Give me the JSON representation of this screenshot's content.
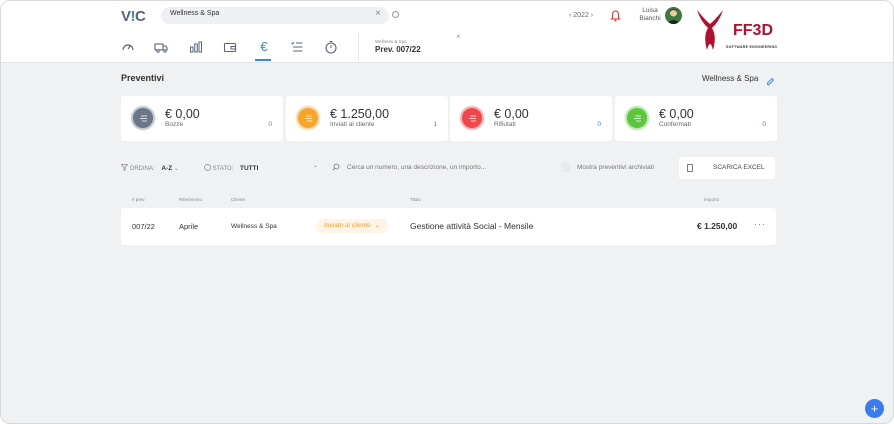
{
  "header": {
    "logo_text": "V",
    "logo_bang": "!",
    "logo_end": "C",
    "search_value": "Wellness & Spa",
    "search_clear": "×",
    "year": "‹ 2022 ›",
    "user_first": "Luisa",
    "user_last": "Bianchi",
    "brand_name": "FF3D",
    "brand_tagline": "SOFTWARE ENGINEERING",
    "brand_color": "#b2102f"
  },
  "nav": {
    "icons": [
      "dashboard-icon",
      "truck-icon",
      "bar-chart-icon",
      "wallet-icon",
      "euro-icon",
      "checklist-icon",
      "timer-icon"
    ],
    "euro_symbol": "€",
    "active": "euro-icon"
  },
  "doc_tab": {
    "subtitle": "Wellness & Spa",
    "title": "Prev. 007/22",
    "close": "×"
  },
  "page": {
    "title": "Preventivi",
    "client": "Wellness & Spa"
  },
  "cards": [
    {
      "amount": "€ 0,00",
      "label": "Bozze",
      "count": "0",
      "color": "#6b7689"
    },
    {
      "amount": "€ 1.250,00",
      "label": "Inviati al cliente",
      "count": "1",
      "color": "#f7a52b"
    },
    {
      "amount": "€ 0,00",
      "label": "Rifiutati",
      "count": "0",
      "color": "#f0474a"
    },
    {
      "amount": "€ 0,00",
      "label": "Confermati",
      "count": "0",
      "color": "#5cc73d"
    }
  ],
  "filters": {
    "order_label": "ORDINA:",
    "order_value": "A-Z",
    "state_label": "STATO:",
    "state_value": "TUTTI",
    "search_placeholder": "Cerca un numero, una descrizione, un importo...",
    "archived_label": "Mostra preventivi archiviati",
    "excel_button": "SCARICA EXCEL"
  },
  "table": {
    "columns": [
      "# prev.",
      "Riferimento",
      "Cliente",
      "Titolo",
      "Importo"
    ],
    "rows": [
      {
        "number": "007/22",
        "reference": "Aprile",
        "client": "Wellness & Spa",
        "status": "Inviato al cliente",
        "title": "Gestione attività Social - Mensile",
        "amount": "€ 1.250,00",
        "more": "···"
      }
    ]
  },
  "fab_label": "+"
}
